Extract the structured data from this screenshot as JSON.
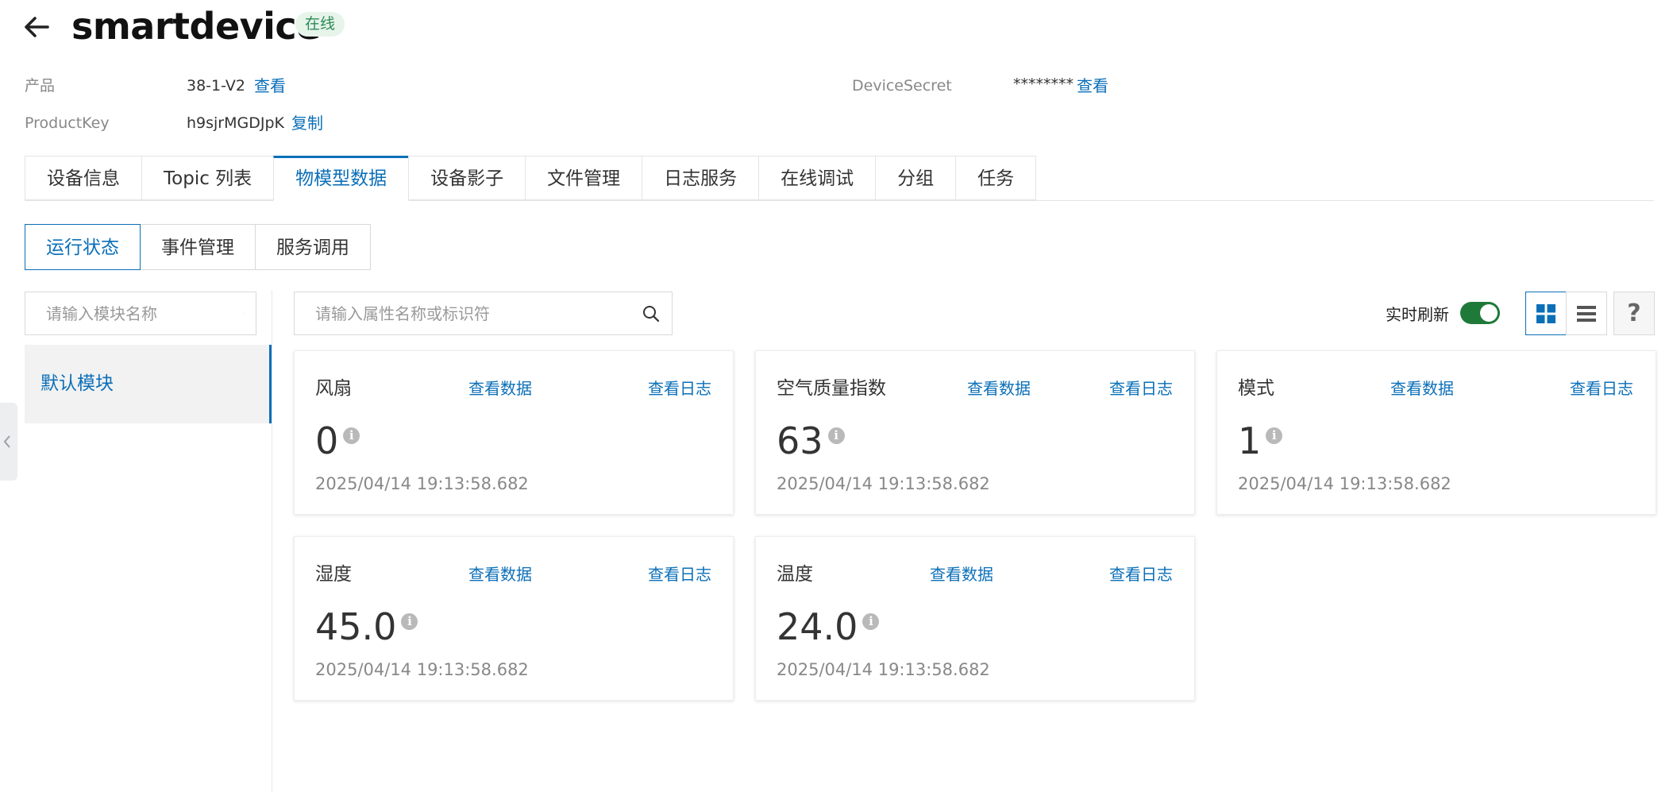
{
  "header": {
    "title": "smartdevice",
    "status": "在线"
  },
  "meta": {
    "product_label": "产品",
    "product_value": "38-1-V2",
    "product_link": "查看",
    "productkey_label": "ProductKey",
    "productkey_value": "h9sjrMGDJpK",
    "productkey_link": "复制",
    "secret_label": "DeviceSecret",
    "secret_value": "********",
    "secret_link": "查看"
  },
  "tabs": [
    {
      "label": "设备信息"
    },
    {
      "label": "Topic 列表"
    },
    {
      "label": "物模型数据",
      "active": true
    },
    {
      "label": "设备影子"
    },
    {
      "label": "文件管理"
    },
    {
      "label": "日志服务"
    },
    {
      "label": "在线调试"
    },
    {
      "label": "分组"
    },
    {
      "label": "任务"
    }
  ],
  "subtabs": [
    {
      "label": "运行状态",
      "active": true
    },
    {
      "label": "事件管理"
    },
    {
      "label": "服务调用"
    }
  ],
  "sidebar": {
    "search_placeholder": "请输入模块名称",
    "modules": [
      {
        "label": "默认模块",
        "selected": true
      }
    ]
  },
  "toolbar": {
    "search_placeholder": "请输入属性名称或标识符",
    "realtime_label": "实时刷新",
    "realtime_on": true,
    "view_mode": "grid",
    "help": "?"
  },
  "cards": [
    {
      "name": "风扇",
      "view_data": "查看数据",
      "view_log": "查看日志",
      "value": "0",
      "time": "2025/04/14 19:13:58.682"
    },
    {
      "name": "空气质量指数",
      "view_data": "查看数据",
      "view_log": "查看日志",
      "value": "63",
      "time": "2025/04/14 19:13:58.682"
    },
    {
      "name": "模式",
      "view_data": "查看数据",
      "view_log": "查看日志",
      "value": "1",
      "time": "2025/04/14 19:13:58.682"
    },
    {
      "name": "湿度",
      "view_data": "查看数据",
      "view_log": "查看日志",
      "value": "45.0",
      "time": "2025/04/14 19:13:58.682"
    },
    {
      "name": "温度",
      "view_data": "查看数据",
      "view_log": "查看日志",
      "value": "24.0",
      "time": "2025/04/14 19:13:58.682"
    }
  ],
  "colors": {
    "accent": "#0b6fb8",
    "online": "#2e8b57",
    "toggle_on": "#1f7a3a"
  }
}
